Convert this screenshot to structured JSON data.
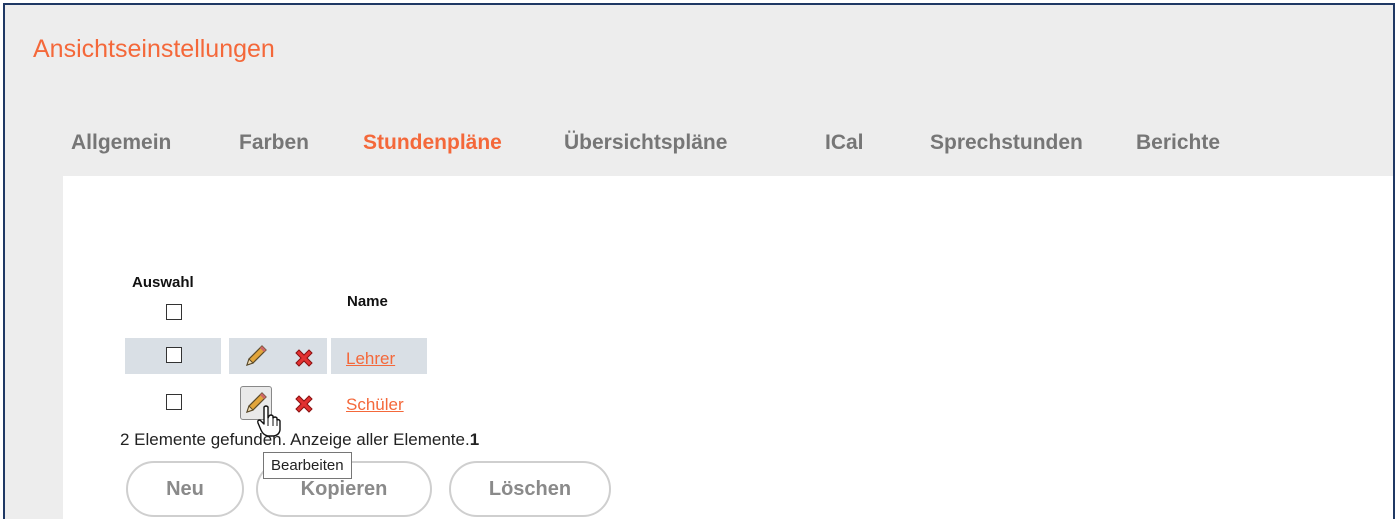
{
  "page": {
    "title": "Ansichtseinstellungen"
  },
  "tabs": [
    {
      "label": "Allgemein",
      "active": false
    },
    {
      "label": "Farben",
      "active": false
    },
    {
      "label": "Stundenpläne",
      "active": true
    },
    {
      "label": "Übersichtspläne",
      "active": false
    },
    {
      "label": "ICal",
      "active": false
    },
    {
      "label": "Sprechstunden",
      "active": false
    },
    {
      "label": "Berichte",
      "active": false
    }
  ],
  "table": {
    "headers": {
      "select": "Auswahl",
      "name": "Name"
    },
    "rows": [
      {
        "name": "Lehrer",
        "checked": false,
        "edit_icon": "pencil-icon",
        "delete_icon": "red-x-icon"
      },
      {
        "name": "Schüler",
        "checked": false,
        "edit_icon": "pencil-icon",
        "delete_icon": "red-x-icon"
      }
    ]
  },
  "status": {
    "text": "2 Elemente gefunden. Anzeige aller Elemente.",
    "page": "1"
  },
  "buttons": {
    "new": "Neu",
    "copy": "Kopieren",
    "delete": "Löschen"
  },
  "tooltip": {
    "text": "Bearbeiten"
  },
  "colors": {
    "accent": "#f4683a",
    "tab_inactive": "#767676",
    "row_highlight": "#d9dfe5",
    "frame_border": "#1f3864"
  }
}
